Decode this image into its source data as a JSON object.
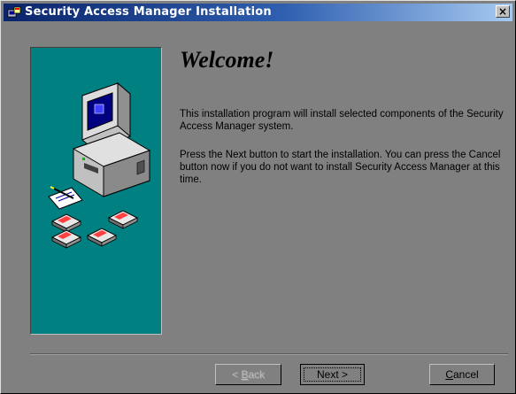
{
  "window": {
    "title": "Security Access Manager Installation",
    "close_glyph": "×"
  },
  "content": {
    "heading": "Welcome!",
    "paragraph1": "This installation program will install selected components of the Security Access Manager system.",
    "paragraph2": "Press the Next button to start the installation. You can press the Cancel button now if you do not want to install Security Access Manager at this time."
  },
  "buttons": {
    "back": {
      "label_first": "<",
      "label_accel": "B",
      "label_rest": "ack",
      "enabled": false
    },
    "next": {
      "label": "Next >",
      "enabled": true,
      "focused": true
    },
    "cancel": {
      "label_accel": "C",
      "label_rest": "ancel",
      "enabled": true
    }
  },
  "colors": {
    "titlebar_start": "#0a246a",
    "titlebar_end": "#a6caf0",
    "side_panel": "#008080",
    "dialog_background": "#808080"
  },
  "icons": {
    "title": "setup-icon",
    "illustration": "computer-with-floppy-disks"
  }
}
